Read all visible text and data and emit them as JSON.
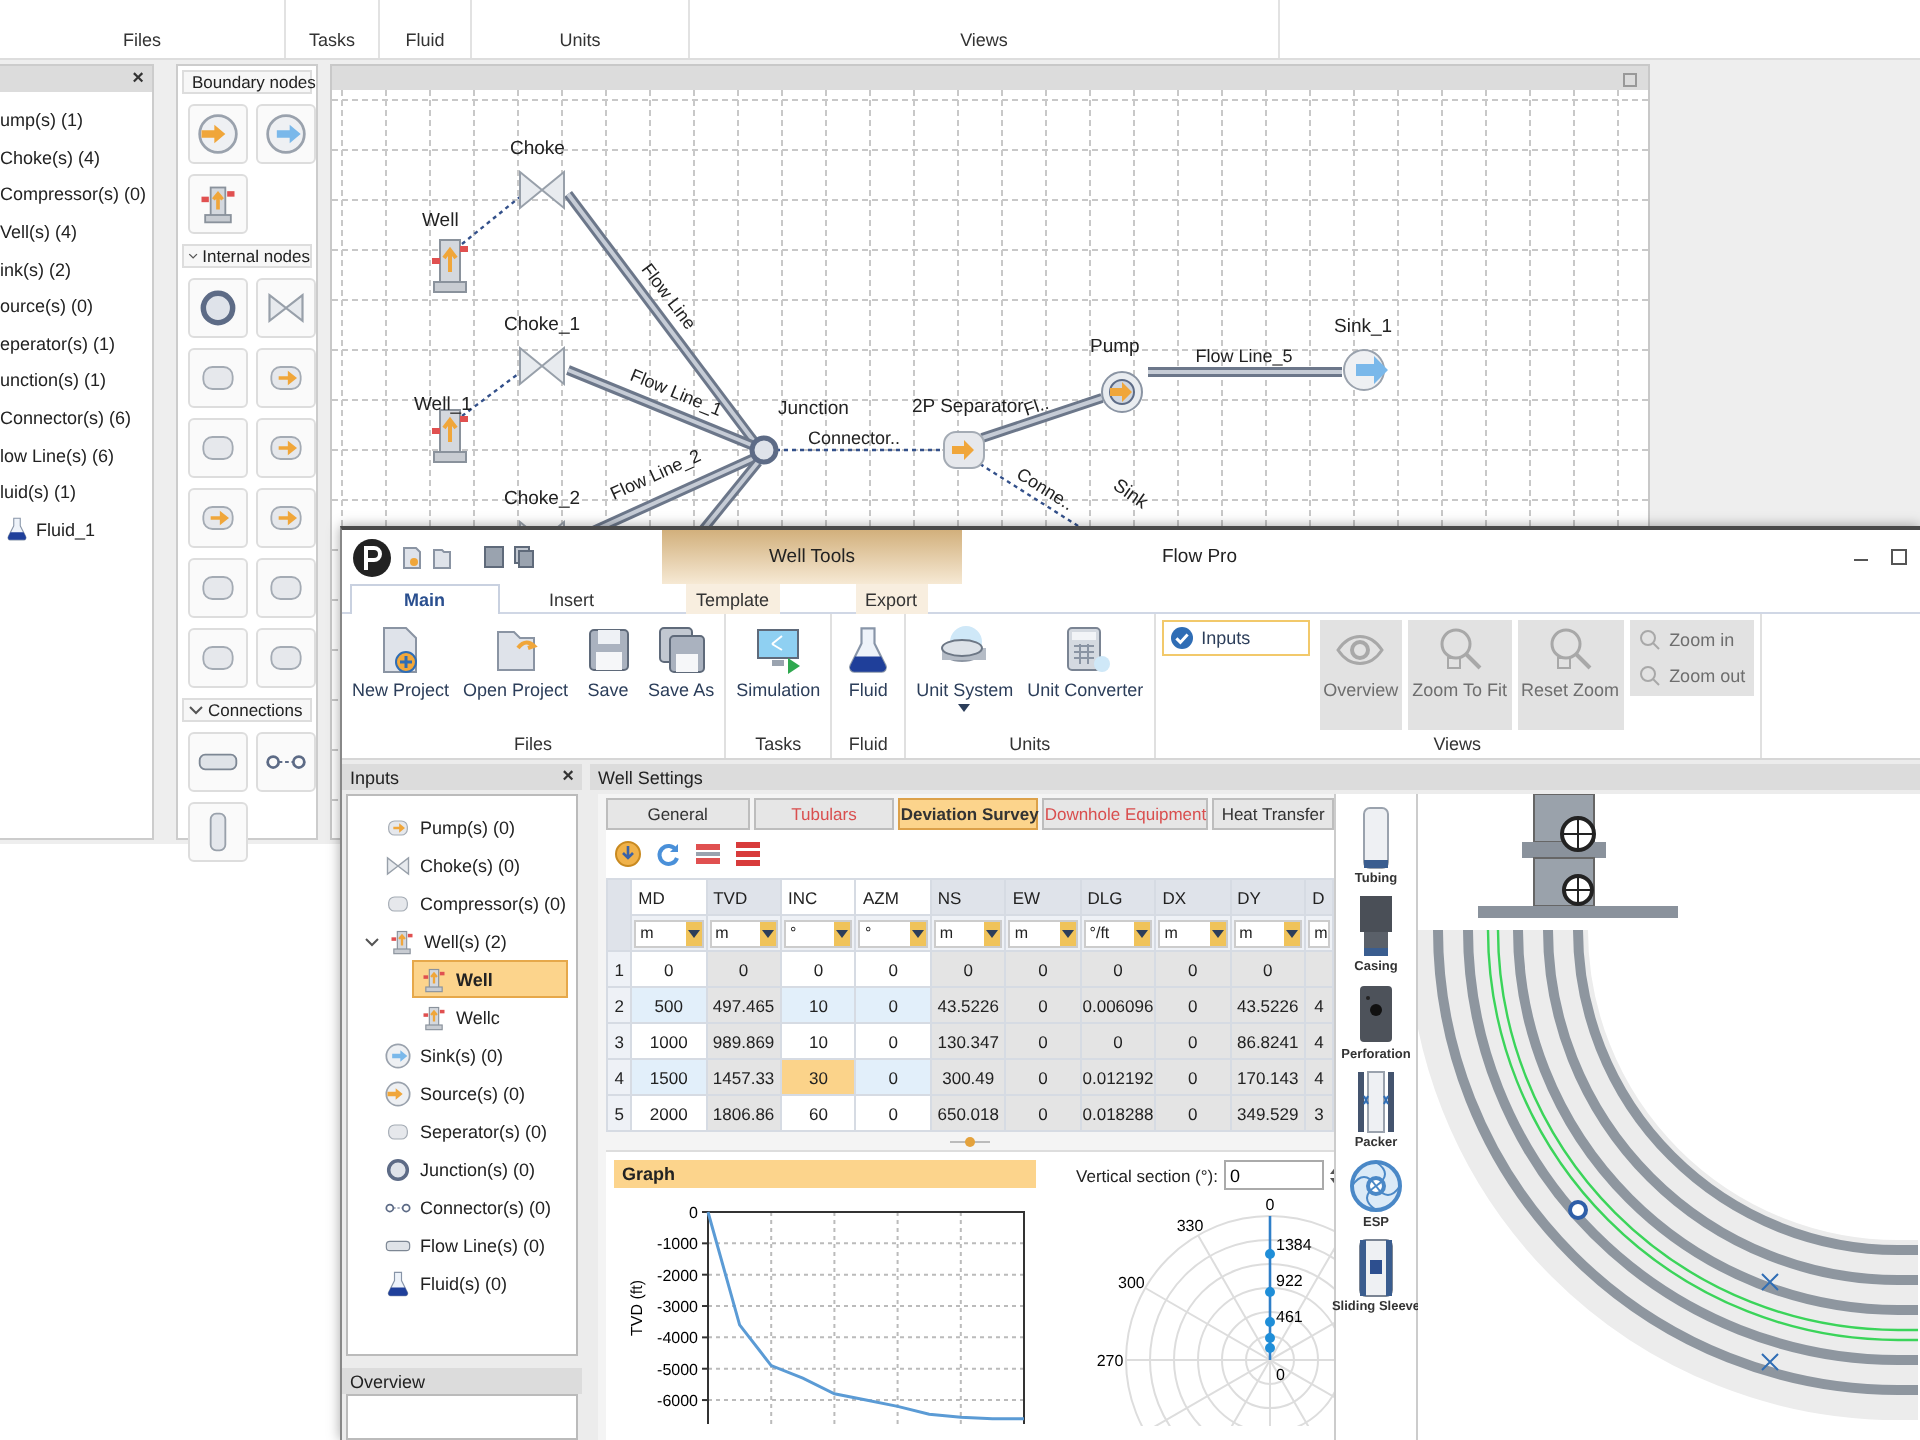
{
  "back_window": {
    "ribbon_groups": [
      "Files",
      "Tasks",
      "Fluid",
      "Units",
      "Views"
    ],
    "model_panel": {
      "close_glyph": "×",
      "items": [
        {
          "label": "ump(s) (1)"
        },
        {
          "label": "Choke(s) (4)"
        },
        {
          "label": "Compressor(s) (0)"
        },
        {
          "label": "Vell(s) (4)"
        },
        {
          "label": "ink(s) (2)"
        },
        {
          "label": "ource(s) (0)"
        },
        {
          "label": "eperator(s) (1)"
        },
        {
          "label": "unction(s) (1)"
        },
        {
          "label": "Connector(s) (6)"
        },
        {
          "label": "low Line(s) (6)"
        },
        {
          "label": "luid(s) (1)",
          "children": [
            {
              "label": "Fluid_1"
            }
          ]
        }
      ]
    },
    "palette": {
      "sections": [
        {
          "title": "Boundary nodes",
          "tools": [
            {
              "kind": "source"
            },
            {
              "kind": "sink"
            },
            {
              "kind": "well"
            }
          ]
        },
        {
          "title": "Internal nodes",
          "tools": [
            {
              "kind": "junction"
            },
            {
              "kind": "choke"
            },
            {
              "kind": "valve"
            },
            {
              "kind": "arrow"
            },
            {
              "kind": "plain"
            },
            {
              "kind": "pump"
            },
            {
              "kind": "mixer"
            },
            {
              "kind": "arrow"
            },
            {
              "kind": "plain"
            },
            {
              "kind": "plain"
            },
            {
              "kind": "plain"
            },
            {
              "kind": "meter"
            }
          ]
        },
        {
          "title": "Connections",
          "tools": [
            {
              "kind": "pipe"
            },
            {
              "kind": "connector"
            },
            {
              "kind": "pipe_v"
            }
          ]
        }
      ]
    },
    "canvas": {
      "nodes": [
        {
          "kind": "choke",
          "label": "Choke"
        },
        {
          "kind": "well",
          "label": "Well"
        },
        {
          "kind": "choke",
          "label": "Choke_1"
        },
        {
          "kind": "well",
          "label": "Well_1"
        },
        {
          "kind": "choke",
          "label": "Choke_2"
        },
        {
          "kind": "junction",
          "label": "Junction"
        },
        {
          "kind": "separator",
          "label": "2P Separator"
        },
        {
          "kind": "pump",
          "label": "Pump"
        },
        {
          "kind": "sink",
          "label": "Sink_1"
        },
        {
          "kind": "sink",
          "label": "Sink"
        }
      ],
      "links": [
        {
          "kind": "pipe",
          "label": "Flow Line"
        },
        {
          "kind": "pipe",
          "label": "Flow Line_1"
        },
        {
          "kind": "pipe",
          "label": "Flow Line_2"
        },
        {
          "kind": "pipe"
        },
        {
          "kind": "connector",
          "label": "Connector.."
        },
        {
          "kind": "pipe",
          "label": "Fl.."
        },
        {
          "kind": "pipe",
          "label": "Flow Line_5"
        },
        {
          "kind": "connector",
          "label": "Conne.."
        },
        {
          "kind": "connector"
        },
        {
          "kind": "connector"
        }
      ]
    }
  },
  "app_window": {
    "title": "Flow Pro",
    "context_group": "Well Tools",
    "tabs": [
      {
        "label": "Main",
        "selected": true,
        "contextual": false
      },
      {
        "label": "Insert",
        "selected": false,
        "contextual": false
      },
      {
        "label": "Template",
        "selected": false,
        "contextual": true
      },
      {
        "label": "Export",
        "selected": false,
        "contextual": true
      }
    ],
    "ribbon": [
      {
        "label": "Files",
        "items": [
          {
            "kind": "new",
            "label": "New Project",
            "disabled": false
          },
          {
            "kind": "open",
            "label": "Open Project",
            "disabled": false
          },
          {
            "kind": "save",
            "label": "Save",
            "disabled": false
          },
          {
            "kind": "saveas",
            "label": "Save As",
            "disabled": false
          }
        ]
      },
      {
        "label": "Tasks",
        "items": [
          {
            "kind": "simulation",
            "label": "Simulation",
            "disabled": false
          }
        ]
      },
      {
        "label": "Fluid",
        "items": [
          {
            "kind": "flask",
            "label": "Fluid",
            "disabled": false
          }
        ]
      },
      {
        "label": "Units",
        "items": [
          {
            "kind": "units",
            "label": "Unit System",
            "disabled": false,
            "menu": true
          },
          {
            "kind": "calculator",
            "label": "Unit Converter",
            "disabled": false,
            "menu": false
          }
        ]
      },
      {
        "label": "Views",
        "items": [
          {
            "kind": "checkbox",
            "label": "Inputs",
            "checked": true
          },
          {
            "kind": "overview",
            "label": "Overview",
            "disabled": true
          },
          {
            "kind": "zoomfit",
            "label": "Zoom To Fit",
            "disabled": true
          },
          {
            "kind": "resetzoom",
            "label": "Reset Zoom",
            "disabled": true
          },
          {
            "kind": "zoomin",
            "label": "Zoom in",
            "disabled": true
          },
          {
            "kind": "zoomout",
            "label": "Zoom out",
            "disabled": true
          }
        ]
      }
    ],
    "inputs_panel": {
      "title": "Inputs",
      "close_glyph": "×",
      "items": [
        {
          "kind": "pump",
          "label": "Pump(s) (0)",
          "selected": false
        },
        {
          "kind": "choke",
          "label": "Choke(s) (0)",
          "selected": false
        },
        {
          "kind": "compressor",
          "label": "Compressor(s) (0)",
          "selected": false
        },
        {
          "kind": "well",
          "label": "Well(s) (2)",
          "selected": false,
          "expanded": true,
          "children": [
            {
              "kind": "well",
              "label": "Well",
              "selected": true
            },
            {
              "kind": "well",
              "label": "Wellc",
              "selected": false
            }
          ]
        },
        {
          "kind": "sink",
          "label": "Sink(s) (0)",
          "selected": false
        },
        {
          "kind": "source",
          "label": "Source(s) (0)",
          "selected": false
        },
        {
          "kind": "separator",
          "label": "Seperator(s) (0)",
          "selected": false
        },
        {
          "kind": "junction",
          "label": "Junction(s) (0)",
          "selected": false
        },
        {
          "kind": "connector",
          "label": "Connector(s) (0)",
          "selected": false
        },
        {
          "kind": "flowline",
          "label": "Flow Line(s) (0)",
          "selected": false
        },
        {
          "kind": "fluid",
          "label": "Fluid(s) (0)",
          "selected": false
        }
      ]
    },
    "overview_panel": {
      "title": "Overview"
    },
    "well_settings": {
      "title": "Well Settings",
      "tabs": [
        {
          "label": "General",
          "selected": false,
          "warning": false
        },
        {
          "label": "Tubulars",
          "selected": false,
          "warning": true
        },
        {
          "label": "Deviation Survey",
          "selected": true,
          "warning": false
        },
        {
          "label": "Downhole Equipment",
          "selected": false,
          "warning": true
        },
        {
          "label": "Heat Transfer",
          "selected": false,
          "warning": false
        }
      ],
      "toolbar": [
        {
          "kind": "import"
        },
        {
          "kind": "refresh"
        },
        {
          "kind": "insert_row"
        },
        {
          "kind": "delete_rows"
        }
      ],
      "table": {
        "columns": [
          {
            "name": "MD",
            "unit": "m",
            "editable": true
          },
          {
            "name": "TVD",
            "unit": "m",
            "editable": false
          },
          {
            "name": "INC",
            "unit": "°",
            "editable": true
          },
          {
            "name": "AZM",
            "unit": "°",
            "editable": true
          },
          {
            "name": "NS",
            "unit": "m",
            "editable": false
          },
          {
            "name": "EW",
            "unit": "m",
            "editable": false
          },
          {
            "name": "DLG",
            "unit": "°/ft",
            "editable": false
          },
          {
            "name": "DX",
            "unit": "m",
            "editable": false
          },
          {
            "name": "DY",
            "unit": "m",
            "editable": false
          },
          {
            "name": "D",
            "unit": "m",
            "editable": false
          }
        ],
        "rows": [
          {
            "number": "1",
            "cells": [
              {
                "value": "0",
                "selected": false
              },
              {
                "value": "0",
                "selected": false
              },
              {
                "value": "0",
                "selected": false
              },
              {
                "value": "0",
                "selected": false
              },
              {
                "value": "0",
                "selected": false
              },
              {
                "value": "0",
                "selected": false
              },
              {
                "value": "0",
                "selected": false
              },
              {
                "value": "0",
                "selected": false
              },
              {
                "value": "0",
                "selected": false
              }
            ]
          },
          {
            "number": "2",
            "cells": [
              {
                "value": "500",
                "selected": false
              },
              {
                "value": "497.465",
                "selected": false
              },
              {
                "value": "10",
                "selected": false
              },
              {
                "value": "0",
                "selected": false
              },
              {
                "value": "43.5226",
                "selected": false
              },
              {
                "value": "0",
                "selected": false
              },
              {
                "value": "0.006096",
                "selected": false
              },
              {
                "value": "0",
                "selected": false
              },
              {
                "value": "43.5226",
                "selected": false
              },
              {
                "value": "4",
                "selected": false
              }
            ]
          },
          {
            "number": "3",
            "cells": [
              {
                "value": "1000",
                "selected": false
              },
              {
                "value": "989.869",
                "selected": false
              },
              {
                "value": "10",
                "selected": false
              },
              {
                "value": "0",
                "selected": false
              },
              {
                "value": "130.347",
                "selected": false
              },
              {
                "value": "0",
                "selected": false
              },
              {
                "value": "0",
                "selected": false
              },
              {
                "value": "0",
                "selected": false
              },
              {
                "value": "86.8241",
                "selected": false
              },
              {
                "value": "4",
                "selected": false
              }
            ]
          },
          {
            "number": "4",
            "cells": [
              {
                "value": "1500",
                "selected": false
              },
              {
                "value": "1457.33",
                "selected": false
              },
              {
                "value": "30",
                "selected": true
              },
              {
                "value": "0",
                "selected": false
              },
              {
                "value": "300.49",
                "selected": false
              },
              {
                "value": "0",
                "selected": false
              },
              {
                "value": "0.012192",
                "selected": false
              },
              {
                "value": "0",
                "selected": false
              },
              {
                "value": "170.143",
                "selected": false
              },
              {
                "value": "4",
                "selected": false
              }
            ]
          },
          {
            "number": "5",
            "cells": [
              {
                "value": "2000",
                "selected": false
              },
              {
                "value": "1806.86",
                "selected": false
              },
              {
                "value": "60",
                "selected": false
              },
              {
                "value": "0",
                "selected": false
              },
              {
                "value": "650.018",
                "selected": false
              },
              {
                "value": "0",
                "selected": false
              },
              {
                "value": "0.018288",
                "selected": false
              },
              {
                "value": "0",
                "selected": false
              },
              {
                "value": "349.529",
                "selected": false
              },
              {
                "value": "3",
                "selected": false
              }
            ]
          }
        ]
      },
      "graph": {
        "title": "Graph",
        "chart_data": {
          "type": "line",
          "grid": true,
          "ylabel": "TVD (ft)",
          "ylim": [
            -7000,
            0
          ],
          "yticks": [
            0,
            -1000,
            -2000,
            -3000,
            -4000,
            -5000,
            -6000
          ],
          "categories": [
            null,
            null,
            null,
            null,
            null,
            null,
            null,
            null,
            null,
            null,
            null
          ],
          "values": [
            0,
            -3600,
            -4900,
            -5300,
            -5800,
            -6000,
            -6200,
            -6450,
            -6550,
            -6600,
            -6600
          ]
        }
      },
      "vertical_section": {
        "label": "Vertical section (°):",
        "value": "0"
      },
      "polar_plot": {
        "angle_labels": [
          "0",
          "330",
          "300",
          "270"
        ],
        "radius_labels": [
          "1384",
          "922",
          "461",
          "0"
        ]
      },
      "equipment": [
        {
          "kind": "tubing",
          "label": "Tubing"
        },
        {
          "kind": "casing",
          "label": "Casing"
        },
        {
          "kind": "perforation",
          "label": "Perforation"
        },
        {
          "kind": "packer",
          "label": "Packer"
        },
        {
          "kind": "esp",
          "label": "ESP"
        },
        {
          "kind": "sleeve",
          "label": "Sliding Sleeve"
        }
      ]
    }
  }
}
